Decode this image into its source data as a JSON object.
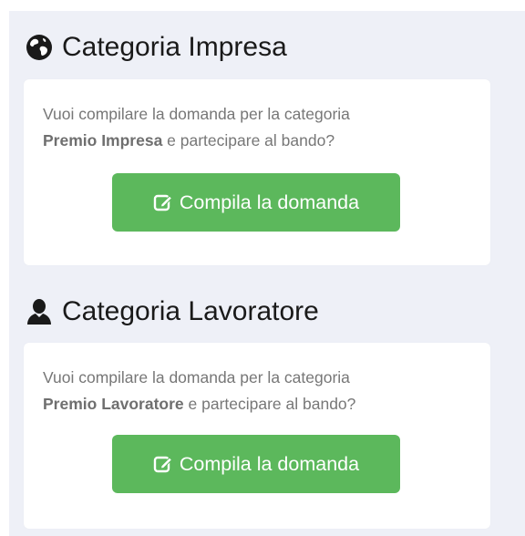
{
  "sections": [
    {
      "icon": "globe-icon",
      "title": "Categoria Impresa",
      "text_before": "Vuoi compilare la domanda per la categoria",
      "category_bold": "Premio Impresa",
      "text_after": " e partecipare al bando?",
      "button": {
        "icon": "edit-icon",
        "label": "Compila la domanda",
        "color": "#5cb85c"
      }
    },
    {
      "icon": "user-icon",
      "title": "Categoria Lavoratore",
      "text_before": "Vuoi compilare la domanda per la categoria",
      "category_bold": "Premio Lavoratore",
      "text_after": " e partecipare al bando?",
      "button": {
        "icon": "edit-icon",
        "label": "Compila la domanda",
        "color": "#5cb85c"
      }
    }
  ]
}
